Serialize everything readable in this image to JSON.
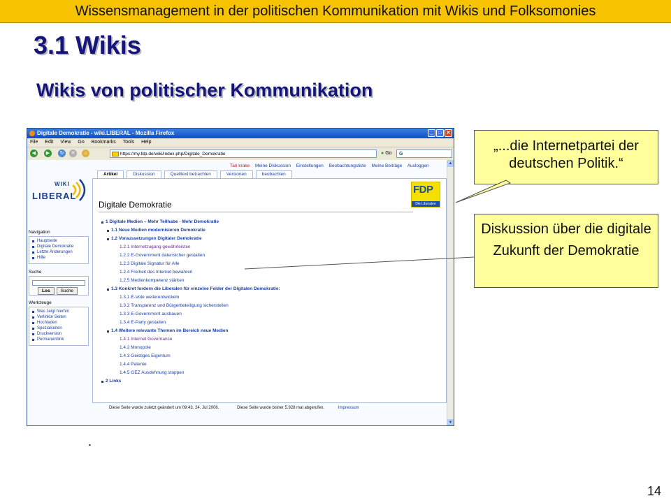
{
  "slide": {
    "header": "Wissensmanagement in der politischen Kommunikation mit Wikis und Folksomonies",
    "title": "3.1 Wikis",
    "subtitle": "Wikis von politischer Kommunikation",
    "dot": ".",
    "page_number": "14"
  },
  "callouts": {
    "quote": "„...die Internetpartei der deutschen Politik.“",
    "discussion": "Diskussion über die digitale Zukunft der Demokratie"
  },
  "browser": {
    "window_title": "Digitale Demokratie - wiki.LIBERAL - Mozilla Firefox",
    "menu": [
      "File",
      "Edit",
      "View",
      "Go",
      "Bookmarks",
      "Tools",
      "Help"
    ],
    "url": "https://my.fdp.de/wiki/index.php/Digitale_Demokratie",
    "go_label": "Go",
    "search_letter": "G"
  },
  "wiki": {
    "logo_top": "WIKI",
    "logo_bottom": "LIBERAL",
    "fdp_logo": "FDP",
    "fdp_logo_sub": "Die Liberalen",
    "user_links": {
      "user": "Tari krake",
      "items": [
        "Meine Diskussion",
        "Einstellungen",
        "Beobachtungsliste",
        "Meine Beiträge",
        "Ausloggen"
      ]
    },
    "tabs": [
      "Artikel",
      "Diskussion",
      "Quelltext betrachten",
      "Versionen",
      "beobachten"
    ],
    "page_heading": "Digitale Demokratie",
    "toc": [
      {
        "level": 1,
        "text": "1 Digitale Medien – Mehr Teilhabe - Mehr Demokratie"
      },
      {
        "level": 2,
        "text": "1.1 Neue Medien modernisieren Demokratie"
      },
      {
        "level": 2,
        "text": "1.2 Voraussetzungen Digitaler Demokratie"
      },
      {
        "level": 3,
        "text": "1.2.1 Internetzugang gewährleisten",
        "visited": true
      },
      {
        "level": 3,
        "text": "1.2.2 E-Government datensicher gestalten"
      },
      {
        "level": 3,
        "text": "1.2.3 Digitale Signatur für Alle"
      },
      {
        "level": 3,
        "text": "1.2.4 Freiheit des Internet bewahren"
      },
      {
        "level": 3,
        "text": "1.2.5 Medienkompetenz stärken"
      },
      {
        "level": 2,
        "text": "1.3 Konkret fordern die Liberalen für einzelne Felder der Digitalen Demokratie:"
      },
      {
        "level": 3,
        "text": "1.3.1 E-Vote weiterentwickeln"
      },
      {
        "level": 3,
        "text": "1.3.2 Transparenz und Bürgerbeteiligung sicherstellen"
      },
      {
        "level": 3,
        "text": "1.3.3 E-Government ausbauen"
      },
      {
        "level": 3,
        "text": "1.3.4 E-Party gestalten"
      },
      {
        "level": 2,
        "text": "1.4 Weitere relevante Themen im Bereich neue Medien"
      },
      {
        "level": 3,
        "text": "1.4.1 Internet Governance",
        "visited": true
      },
      {
        "level": 3,
        "text": "1.4.2 Monopole"
      },
      {
        "level": 3,
        "text": "1.4.3 Geistiges Eigentum"
      },
      {
        "level": 3,
        "text": "1.4.4 Patente"
      },
      {
        "level": 3,
        "text": "1.4.5 GEZ Ausdehnung stoppen"
      },
      {
        "level": 1,
        "text": "2 Links"
      }
    ],
    "sidebar": {
      "navigation_label": "Navigation",
      "navigation": [
        "Hauptseite",
        "Digitale Demokratie",
        "Letzte Änderungen",
        "Hilfe"
      ],
      "search_label": "Suche",
      "search_go": "Los",
      "search_button": "Suche",
      "tools_label": "Werkzeuge",
      "tools": [
        "Was zeigt hierhin",
        "Verlinkte Seiten",
        "Hochladen",
        "Spezialseiten",
        "Druckversion",
        "Permanentlink"
      ]
    },
    "footer": {
      "modified": "Diese Seite wurde zuletzt geändert um 09:43, 24. Jul 2006.",
      "views": "Diese Seite wurde bisher 5.928 mal abgerufen.",
      "impressum": "Impressum"
    }
  },
  "colors": {
    "header_bar": "#f7c200",
    "title_text": "#16157a",
    "callout_fill": "#fefe9a",
    "link": "#1a3f9c",
    "fdp_yellow": "#f5e000",
    "fdp_blue": "#1b4fa8"
  }
}
